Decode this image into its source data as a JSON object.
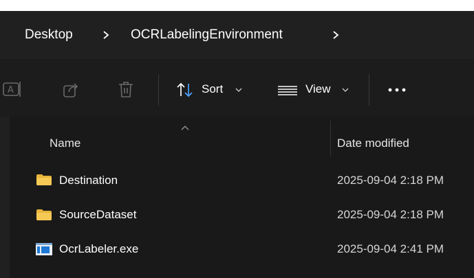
{
  "breadcrumb": {
    "items": [
      "Desktop",
      "OCRLabelingEnvironment"
    ]
  },
  "toolbar": {
    "sort_label": "Sort",
    "view_label": "View"
  },
  "columns": {
    "name": "Name",
    "date_modified": "Date modified"
  },
  "files": [
    {
      "name": "Destination",
      "type": "folder",
      "date": "2025-09-04 2:18 PM"
    },
    {
      "name": "SourceDataset",
      "type": "folder",
      "date": "2025-09-04 2:18 PM"
    },
    {
      "name": "OcrLabeler.exe",
      "type": "exe",
      "date": "2025-09-04 2:41 PM"
    }
  ],
  "icons": {
    "rename": "rename-icon",
    "share": "share-icon",
    "delete": "delete-icon",
    "sort": "sort-arrows-icon",
    "view": "view-lines-icon",
    "more": "more-icon",
    "folder": "folder-icon",
    "exe": "exe-app-icon"
  },
  "colors": {
    "window_bg": "#1c1c1c",
    "folder": "#f2c14e",
    "exe_blue": "#1e78d6"
  }
}
